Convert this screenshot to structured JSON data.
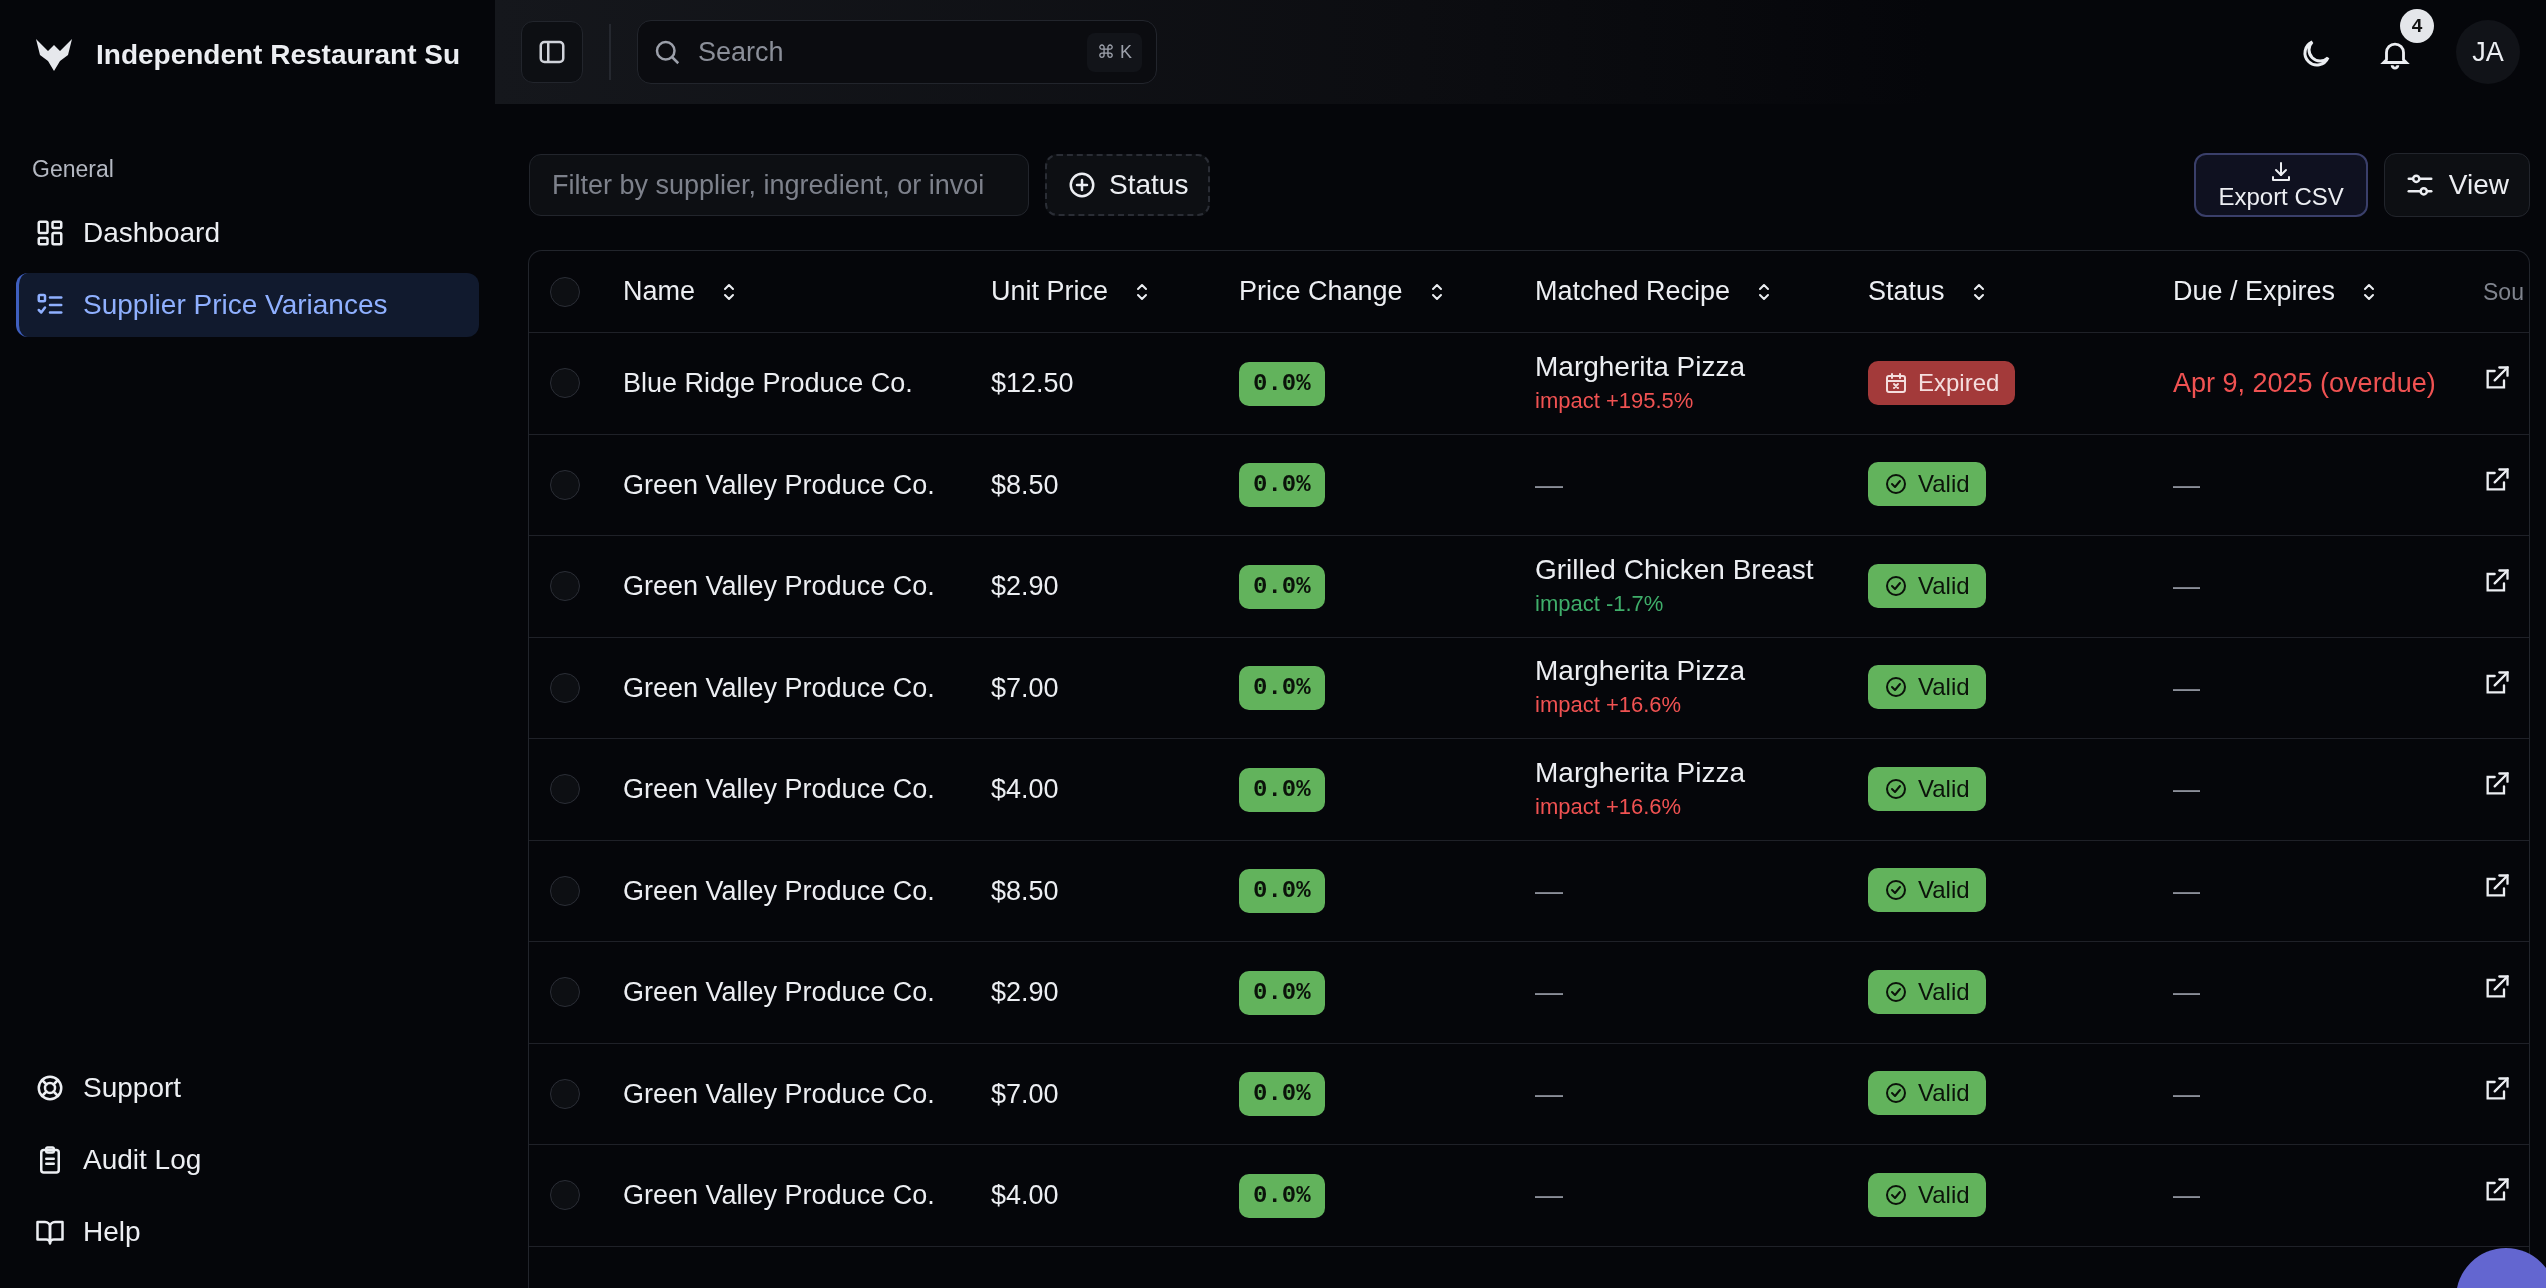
{
  "app": {
    "title": "Independent Restaurant Su"
  },
  "sidebar": {
    "section_label": "General",
    "items": [
      {
        "label": "Dashboard",
        "selected": false
      },
      {
        "label": "Supplier Price Variances",
        "selected": true
      }
    ],
    "footer_items": [
      {
        "label": "Support"
      },
      {
        "label": "Audit Log"
      },
      {
        "label": "Help"
      }
    ]
  },
  "topbar": {
    "search": {
      "placeholder": "Search",
      "shortcut": "⌘ K"
    },
    "notifications": {
      "count": "4"
    },
    "avatar": {
      "initials": "JA"
    }
  },
  "toolbar": {
    "filter": {
      "placeholder": "Filter by supplier, ingredient, or invoi"
    },
    "status_filter": "Status",
    "export_button": "Export CSV",
    "view_button": "View"
  },
  "table": {
    "select_all": {
      "checked": false
    },
    "columns": [
      "Name",
      "Unit Price",
      "Price Change",
      "Matched Recipe",
      "Status",
      "Due / Expires",
      "Sou"
    ],
    "rows": [
      {
        "selected": false,
        "name": "Blue Ridge Produce Co.",
        "unit_price": "$12.50",
        "price_change": "0.0%",
        "recipe": {
          "name": "Margherita Pizza",
          "impact": "impact +195.5%",
          "adverse": true
        },
        "status": {
          "label": "Expired",
          "kind": "expired"
        },
        "due": {
          "text": "Apr 9, 2025 (overdue)",
          "overdue": true
        }
      },
      {
        "selected": false,
        "name": "Green Valley Produce Co.",
        "unit_price": "$8.50",
        "price_change": "0.0%",
        "recipe": {
          "name": "—"
        },
        "status": {
          "label": "Valid",
          "kind": "valid"
        },
        "due": {
          "text": "—",
          "overdue": false
        }
      },
      {
        "selected": false,
        "name": "Green Valley Produce Co.",
        "unit_price": "$2.90",
        "price_change": "0.0%",
        "recipe": {
          "name": "Grilled Chicken Breast",
          "impact": "impact -1.7%",
          "adverse": false
        },
        "status": {
          "label": "Valid",
          "kind": "valid"
        },
        "due": {
          "text": "—",
          "overdue": false
        }
      },
      {
        "selected": false,
        "name": "Green Valley Produce Co.",
        "unit_price": "$7.00",
        "price_change": "0.0%",
        "recipe": {
          "name": "Margherita Pizza",
          "impact": "impact +16.6%",
          "adverse": true
        },
        "status": {
          "label": "Valid",
          "kind": "valid"
        },
        "due": {
          "text": "—",
          "overdue": false
        }
      },
      {
        "selected": false,
        "name": "Green Valley Produce Co.",
        "unit_price": "$4.00",
        "price_change": "0.0%",
        "recipe": {
          "name": "Margherita Pizza",
          "impact": "impact +16.6%",
          "adverse": true
        },
        "status": {
          "label": "Valid",
          "kind": "valid"
        },
        "due": {
          "text": "—",
          "overdue": false
        }
      },
      {
        "selected": false,
        "name": "Green Valley Produce Co.",
        "unit_price": "$8.50",
        "price_change": "0.0%",
        "recipe": {
          "name": "—"
        },
        "status": {
          "label": "Valid",
          "kind": "valid"
        },
        "due": {
          "text": "—",
          "overdue": false
        }
      },
      {
        "selected": false,
        "name": "Green Valley Produce Co.",
        "unit_price": "$2.90",
        "price_change": "0.0%",
        "recipe": {
          "name": "—"
        },
        "status": {
          "label": "Valid",
          "kind": "valid"
        },
        "due": {
          "text": "—",
          "overdue": false
        }
      },
      {
        "selected": false,
        "name": "Green Valley Produce Co.",
        "unit_price": "$7.00",
        "price_change": "0.0%",
        "recipe": {
          "name": "—"
        },
        "status": {
          "label": "Valid",
          "kind": "valid"
        },
        "due": {
          "text": "—",
          "overdue": false
        }
      },
      {
        "selected": false,
        "name": "Green Valley Produce Co.",
        "unit_price": "$4.00",
        "price_change": "0.0%",
        "recipe": {
          "name": "—"
        },
        "status": {
          "label": "Valid",
          "kind": "valid"
        },
        "due": {
          "text": "—",
          "overdue": false
        }
      }
    ]
  }
}
